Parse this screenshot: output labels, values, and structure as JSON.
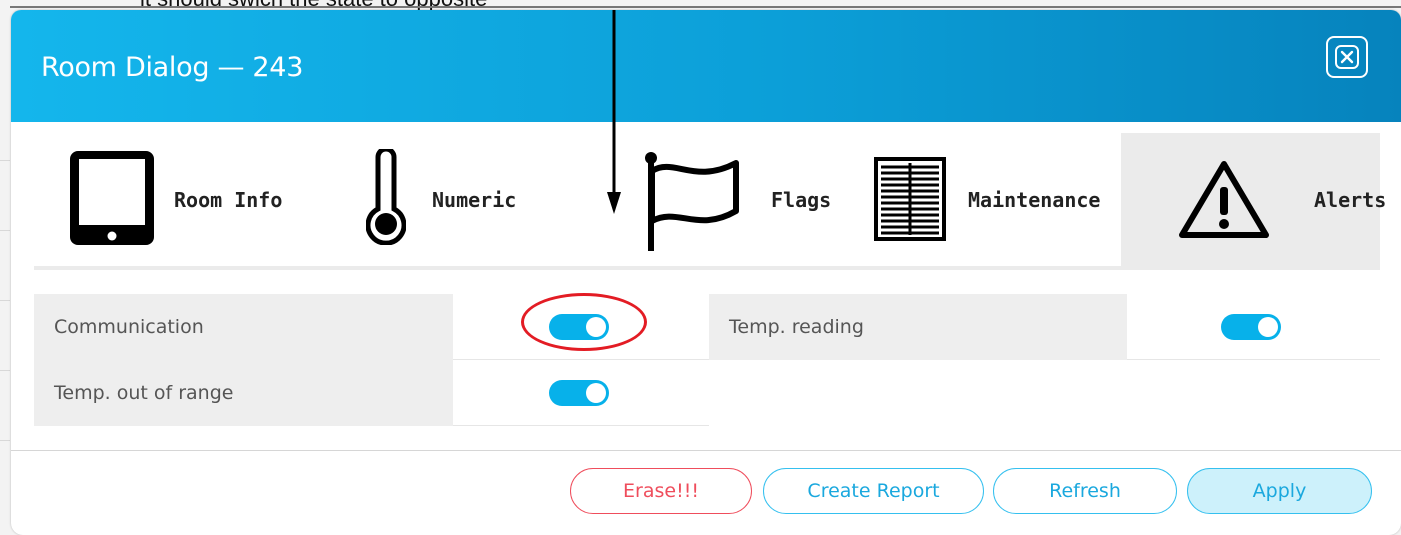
{
  "annotation": {
    "text": "it should swich the state to opposite"
  },
  "dialog": {
    "title": "Room Dialog — 243"
  },
  "tabs": [
    {
      "label": "Room Info",
      "icon": "tablet-icon",
      "active": false
    },
    {
      "label": "Numeric",
      "icon": "thermometer-icon",
      "active": false
    },
    {
      "label": "Flags",
      "icon": "flag-icon",
      "active": false
    },
    {
      "label": "Maintenance",
      "icon": "document-icon",
      "active": false
    },
    {
      "label": "Alerts",
      "icon": "warning-icon",
      "active": true
    }
  ],
  "alerts": [
    {
      "label": "Communication",
      "enabled": true
    },
    {
      "label": "Temp. reading",
      "enabled": true
    },
    {
      "label": "Temp. out of range",
      "enabled": true
    }
  ],
  "buttons": {
    "erase": "Erase!!!",
    "report": "Create Report",
    "refresh": "Refresh",
    "apply": "Apply"
  },
  "colors": {
    "accent": "#0ba6df",
    "toggle_on": "#07b1ea",
    "danger": "#ef4d5c",
    "highlight": "#e31c24"
  }
}
